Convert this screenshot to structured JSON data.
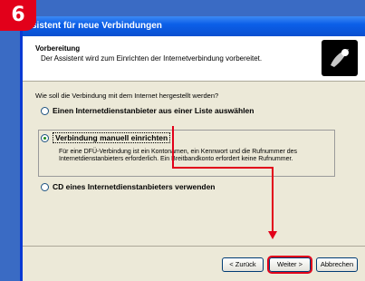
{
  "step_badge": "6",
  "window": {
    "title": "sistent für neue Verbindungen"
  },
  "header": {
    "title": "Vorbereitung",
    "subtitle": "Der Assistent wird zum Einrichten der Internetverbindung vorbereitet."
  },
  "question": "Wie soll die Verbindung mit dem Internet hergestellt werden?",
  "options": [
    {
      "label": "Einen Internetdienstanbieter aus einer Liste auswählen",
      "checked": false
    },
    {
      "label": "Verbindung manuell einrichten",
      "checked": true,
      "description": "Für eine DFÜ-Verbindung ist ein Kontonamen, ein Kennwort und die Rufnummer des Internetdienstanbieters erforderlich. Ein Breitbandkonto erfordert keine Rufnummer."
    },
    {
      "label": "CD eines Internetdienstanbieters verwenden",
      "checked": false
    }
  ],
  "buttons": {
    "back": "< Zurück",
    "next": "Weiter >",
    "cancel": "Abbrechen"
  },
  "colors": {
    "annotation": "#e2001a",
    "titlebar": "#0b5fe8"
  }
}
